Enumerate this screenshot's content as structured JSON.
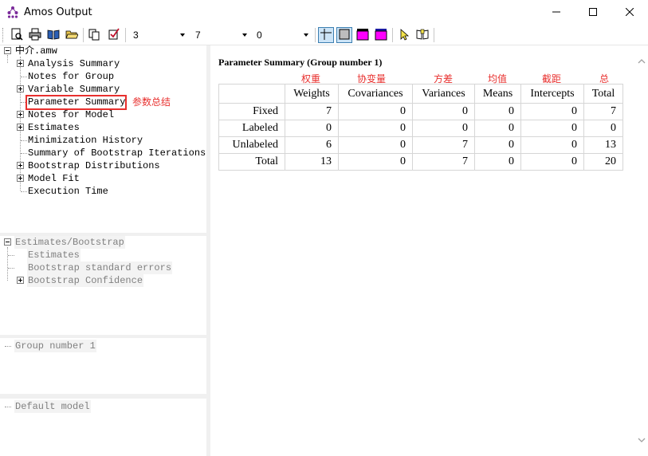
{
  "window": {
    "title": "Amos Output",
    "controls": [
      "minimize-icon",
      "maximize-icon",
      "close-icon"
    ]
  },
  "toolbar": {
    "combo1": "3",
    "combo2": "7",
    "combo3": "0",
    "icons": [
      "print-preview-icon",
      "print-icon",
      "book-open-icon",
      "folder-open-icon",
      "copy-icon",
      "checklist-icon",
      "table-view-icon",
      "text-view-icon",
      "color-magenta-icon",
      "color-magenta-bar-icon",
      "pointer-help-icon",
      "book-help-icon"
    ]
  },
  "tree": {
    "root": "中介.amw",
    "items": [
      {
        "label": "Analysis Summary",
        "expandable": true
      },
      {
        "label": "Notes for Group",
        "expandable": false
      },
      {
        "label": "Variable Summary",
        "expandable": true
      },
      {
        "label": "Parameter Summary",
        "expandable": false,
        "selected": true
      },
      {
        "label": "Notes for Model",
        "expandable": true
      },
      {
        "label": "Estimates",
        "expandable": true
      },
      {
        "label": "Minimization History",
        "expandable": false
      },
      {
        "label": "Summary of Bootstrap Iterations",
        "expandable": false
      },
      {
        "label": "Bootstrap Distributions",
        "expandable": true
      },
      {
        "label": "Model Fit",
        "expandable": true
      },
      {
        "label": "Execution Time",
        "expandable": false
      }
    ],
    "annotation": "参数总结"
  },
  "estimates_panel": {
    "root": "Estimates/Bootstrap",
    "items": [
      "Estimates",
      "Bootstrap standard errors",
      "Bootstrap Confidence"
    ]
  },
  "group_panel": {
    "label": "Group number 1"
  },
  "model_panel": {
    "label": "Default model"
  },
  "content": {
    "title": "Parameter Summary (Group number 1)",
    "column_annotations": [
      "权重",
      "协变量",
      "方差",
      "均值",
      "截距",
      "总"
    ],
    "columns": [
      "Weights",
      "Covariances",
      "Variances",
      "Means",
      "Intercepts",
      "Total"
    ],
    "rows": [
      {
        "label": "Fixed",
        "values": [
          "7",
          "0",
          "0",
          "0",
          "0",
          "7"
        ]
      },
      {
        "label": "Labeled",
        "values": [
          "0",
          "0",
          "0",
          "0",
          "0",
          "0"
        ]
      },
      {
        "label": "Unlabeled",
        "values": [
          "6",
          "0",
          "7",
          "0",
          "0",
          "13"
        ]
      },
      {
        "label": "Total",
        "values": [
          "13",
          "0",
          "7",
          "0",
          "0",
          "20"
        ]
      }
    ]
  },
  "colors": {
    "annotation_red": "#e8302e",
    "magenta": "#ff00ff",
    "tree_dim": "#808080"
  }
}
